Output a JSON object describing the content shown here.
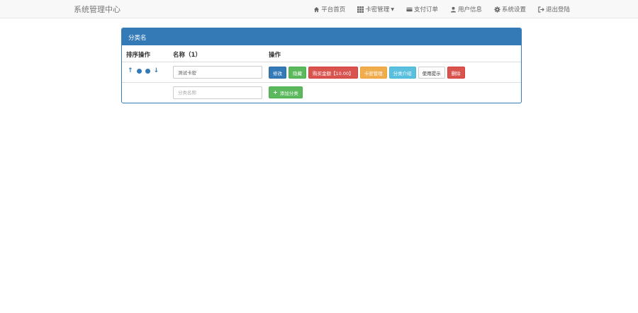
{
  "navbar": {
    "brand": "系统管理中心",
    "items": [
      {
        "label": "平台首页",
        "icon": "home-icon"
      },
      {
        "label": "卡密管理",
        "icon": "grid-icon",
        "dropdown": true
      },
      {
        "label": "支付订单",
        "icon": "credit-card-icon"
      },
      {
        "label": "用户信息",
        "icon": "user-icon"
      },
      {
        "label": "系统设置",
        "icon": "gear-icon"
      },
      {
        "label": "退出登陆",
        "icon": "logout-icon"
      }
    ]
  },
  "panel": {
    "title": "分类名",
    "columns": [
      "排序操作",
      "名称（1）",
      "操作"
    ],
    "rows": [
      {
        "name_value": "测试卡密",
        "sort_icons": [
          "arrow-up-icon",
          "circle-up-icon",
          "circle-down-icon",
          "arrow-down-icon"
        ],
        "actions": [
          {
            "label": "修改",
            "style": "primary"
          },
          {
            "label": "隐藏",
            "style": "success"
          },
          {
            "label": "购买金额【10.00】",
            "style": "danger"
          },
          {
            "label": "卡密管理",
            "style": "warning"
          },
          {
            "label": "分类介绍",
            "style": "info"
          },
          {
            "label": "使用提示",
            "style": "default"
          },
          {
            "label": "删除",
            "style": "danger"
          }
        ]
      }
    ],
    "new_row": {
      "placeholder": "分类名称",
      "add_label": "添加分类"
    }
  },
  "colors": {
    "primary": "#337ab7",
    "success": "#5cb85c",
    "danger": "#d9534f",
    "warning": "#f0ad4e",
    "info": "#5bc0de"
  }
}
